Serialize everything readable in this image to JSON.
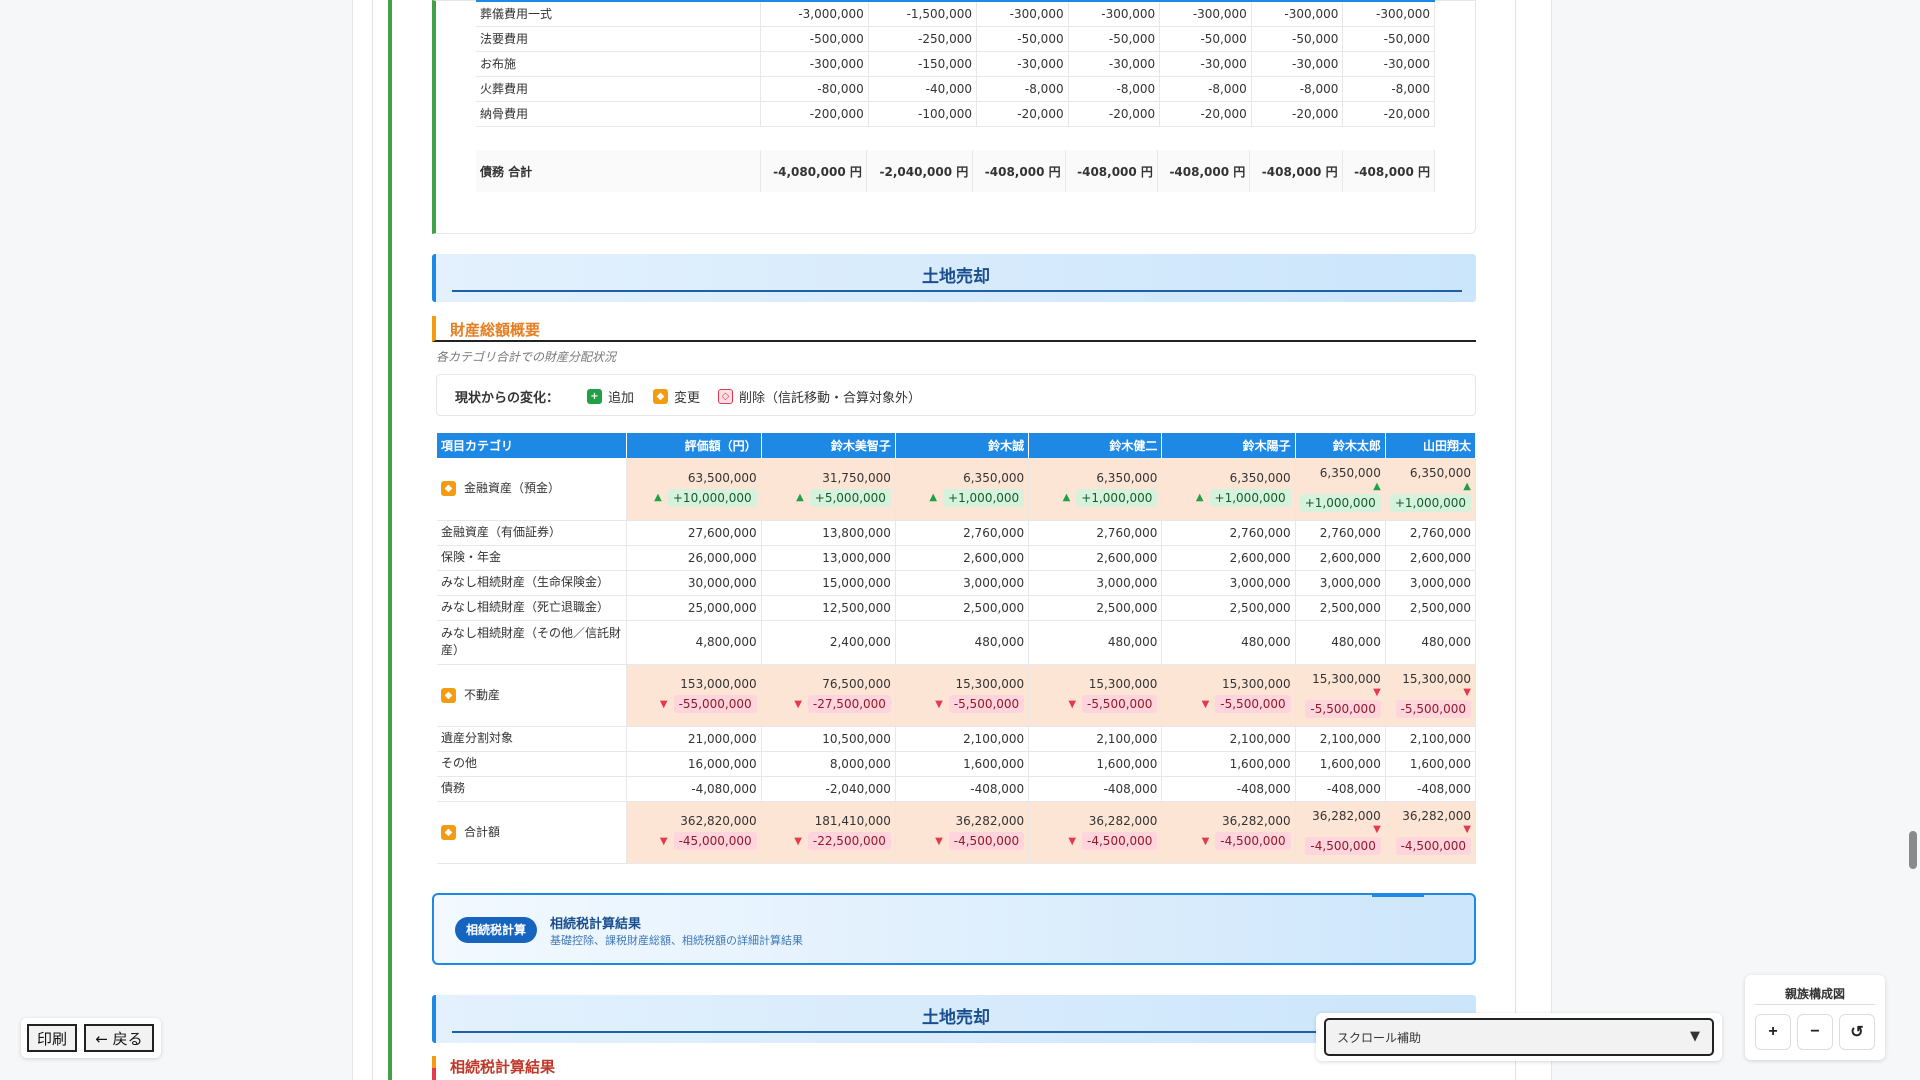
{
  "debts": {
    "rows": [
      {
        "label": "葬儀費用一式",
        "values": [
          "-3,000,000",
          "-1,500,000",
          "-300,000",
          "-300,000",
          "-300,000",
          "-300,000",
          "-300,000"
        ]
      },
      {
        "label": "法要費用",
        "values": [
          "-500,000",
          "-250,000",
          "-50,000",
          "-50,000",
          "-50,000",
          "-50,000",
          "-50,000"
        ]
      },
      {
        "label": "お布施",
        "values": [
          "-300,000",
          "-150,000",
          "-30,000",
          "-30,000",
          "-30,000",
          "-30,000",
          "-30,000"
        ]
      },
      {
        "label": "火葬費用",
        "values": [
          "-80,000",
          "-40,000",
          "-8,000",
          "-8,000",
          "-8,000",
          "-8,000",
          "-8,000"
        ]
      },
      {
        "label": "納骨費用",
        "values": [
          "-200,000",
          "-100,000",
          "-20,000",
          "-20,000",
          "-20,000",
          "-20,000",
          "-20,000"
        ]
      }
    ],
    "total": {
      "label": "債務 合計",
      "values": [
        "-4,080,000 円",
        "-2,040,000 円",
        "-408,000 円",
        "-408,000 円",
        "-408,000 円",
        "-408,000 円",
        "-408,000 円"
      ]
    }
  },
  "section1": {
    "title": "土地売却"
  },
  "overview": {
    "heading": "財産総額概要",
    "note": "各カテゴリ合計での財産分配状況",
    "legend": {
      "label": "現状からの変化：",
      "add": "追加",
      "modify": "変更",
      "delete": "削除（信託移動・合算対象外）"
    }
  },
  "summary": {
    "headers": [
      "項目カテゴリ",
      "評価額（円）",
      "鈴木美智子",
      "鈴木誠",
      "鈴木健二",
      "鈴木陽子",
      "鈴木太郎",
      "山田翔太"
    ],
    "rows": [
      {
        "label": "金融資産（預金）",
        "changed": true,
        "direction": "up",
        "values": [
          "63,500,000",
          "31,750,000",
          "6,350,000",
          "6,350,000",
          "6,350,000",
          "6,350,000",
          "6,350,000"
        ],
        "deltas": [
          "+10,000,000",
          "+5,000,000",
          "+1,000,000",
          "+1,000,000",
          "+1,000,000",
          "+1,000,000",
          "+1,000,000"
        ]
      },
      {
        "label": "金融資産（有価証券）",
        "values": [
          "27,600,000",
          "13,800,000",
          "2,760,000",
          "2,760,000",
          "2,760,000",
          "2,760,000",
          "2,760,000"
        ]
      },
      {
        "label": "保険・年金",
        "values": [
          "26,000,000",
          "13,000,000",
          "2,600,000",
          "2,600,000",
          "2,600,000",
          "2,600,000",
          "2,600,000"
        ]
      },
      {
        "label": "みなし相続財産（生命保険金）",
        "values": [
          "30,000,000",
          "15,000,000",
          "3,000,000",
          "3,000,000",
          "3,000,000",
          "3,000,000",
          "3,000,000"
        ]
      },
      {
        "label": "みなし相続財産（死亡退職金）",
        "values": [
          "25,000,000",
          "12,500,000",
          "2,500,000",
          "2,500,000",
          "2,500,000",
          "2,500,000",
          "2,500,000"
        ]
      },
      {
        "label": "みなし相続財産（その他／信託財産）",
        "tall": true,
        "values": [
          "4,800,000",
          "2,400,000",
          "480,000",
          "480,000",
          "480,000",
          "480,000",
          "480,000"
        ]
      },
      {
        "label": "不動産",
        "changed": true,
        "direction": "down",
        "values": [
          "153,000,000",
          "76,500,000",
          "15,300,000",
          "15,300,000",
          "15,300,000",
          "15,300,000",
          "15,300,000"
        ],
        "deltas": [
          "-55,000,000",
          "-27,500,000",
          "-5,500,000",
          "-5,500,000",
          "-5,500,000",
          "-5,500,000",
          "-5,500,000"
        ]
      },
      {
        "label": "遺産分割対象",
        "values": [
          "21,000,000",
          "10,500,000",
          "2,100,000",
          "2,100,000",
          "2,100,000",
          "2,100,000",
          "2,100,000"
        ]
      },
      {
        "label": "その他",
        "values": [
          "16,000,000",
          "8,000,000",
          "1,600,000",
          "1,600,000",
          "1,600,000",
          "1,600,000",
          "1,600,000"
        ]
      },
      {
        "label": "債務",
        "values": [
          "-4,080,000",
          "-2,040,000",
          "-408,000",
          "-408,000",
          "-408,000",
          "-408,000",
          "-408,000"
        ]
      },
      {
        "label": "合計額",
        "changed": true,
        "direction": "down",
        "values": [
          "362,820,000",
          "181,410,000",
          "36,282,000",
          "36,282,000",
          "36,282,000",
          "36,282,000",
          "36,282,000"
        ],
        "deltas": [
          "-45,000,000",
          "-22,500,000",
          "-4,500,000",
          "-4,500,000",
          "-4,500,000",
          "-4,500,000",
          "-4,500,000"
        ]
      }
    ]
  },
  "tax_card": {
    "pill": "相続税計算",
    "title": "相続税計算結果",
    "desc": "基礎控除、課税財産総額、相続税額の詳細計算結果"
  },
  "section2": {
    "title": "土地売却"
  },
  "tax_heading": "相続税計算結果",
  "controls": {
    "print": "印刷",
    "back": "← 戻る",
    "scroll_helper": "スクロール補助",
    "family_title": "親族構成図",
    "zoom_in": "+",
    "zoom_out": "−",
    "reset": "↺"
  },
  "colors": {
    "accent": "#1e88e5",
    "rail": "#43a047",
    "heading_orange": "#e67e22",
    "changed_bg": "#fde5d6",
    "increase": "#22a045",
    "decrease": "#e53950"
  },
  "icons": {
    "add": "plus-square-icon",
    "modify": "diamond-square-icon",
    "delete": "diamond-outline-icon",
    "scroll": "triangle-down-icon",
    "reset": "refresh-icon"
  }
}
